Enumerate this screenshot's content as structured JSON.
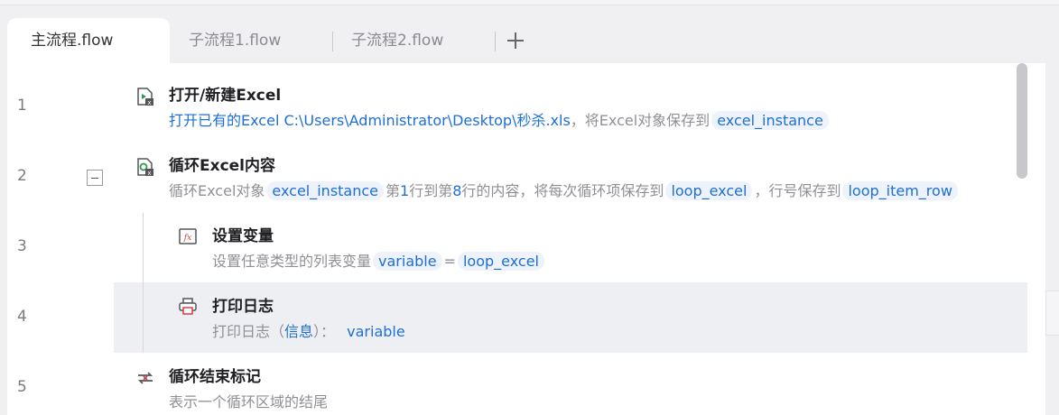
{
  "tabs": [
    {
      "label": "主流程.flow",
      "active": true
    },
    {
      "label": "子流程1.flow",
      "active": false
    },
    {
      "label": "子流程2.flow",
      "active": false
    }
  ],
  "add_tab_icon": "plus-icon",
  "line_numbers": [
    "1",
    "2",
    "3",
    "4",
    "5"
  ],
  "steps": [
    {
      "icon": "excel-open-icon",
      "title": "打开/新建Excel",
      "desc_prefix": "打开已有的Excel C:\\Users\\Administrator\\Desktop\\秒杀.xls",
      "desc_mid": "，将Excel对象保存到",
      "var": "excel_instance"
    },
    {
      "icon": "excel-loop-icon",
      "title": "循环Excel内容",
      "desc_prefix": "循环Excel对象",
      "var1": "excel_instance",
      "desc_mid1": "第",
      "num1": "1",
      "desc_mid2": "行到第",
      "num2": "8",
      "desc_mid3": "行的内容，将每次循环项保存到",
      "var2": "loop_excel",
      "desc_mid4": "，行号保存到",
      "var3": "loop_item_row"
    },
    {
      "icon": "set-variable-icon",
      "title": "设置变量",
      "desc_prefix": "设置任意类型的列表变量",
      "var1": "variable",
      "eq": "=",
      "var2": "loop_excel"
    },
    {
      "icon": "print-log-icon",
      "title": "打印日志",
      "desc_prefix": "打印日志（",
      "level": "信息",
      "desc_suffix": "）：",
      "var": "variable"
    },
    {
      "icon": "loop-end-icon",
      "title": "循环结束标记",
      "desc": "表示一个循环区域的结尾"
    }
  ]
}
